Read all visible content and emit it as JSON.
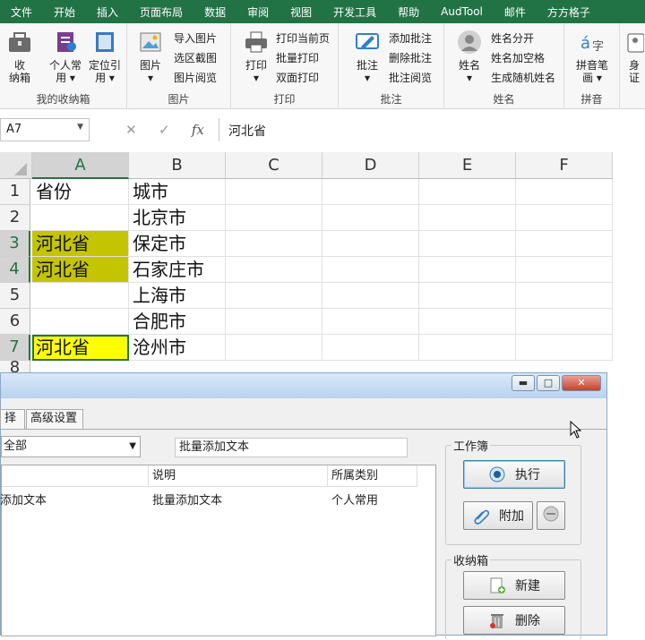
{
  "menu_tabs": [
    "文件",
    "开始",
    "插入",
    "页面布局",
    "数据",
    "审阅",
    "视图",
    "开发工具",
    "帮助",
    "AudTool",
    "邮件",
    "方方格子"
  ],
  "ribbon": {
    "storage": {
      "group_label": "我的收纳箱",
      "btn_collect": "收\n纳箱",
      "btn_personal": "个人常\n用 ▾",
      "btn_locate": "定位引\n用 ▾"
    },
    "picture": {
      "group_label": "图片",
      "btn_picture": "图片\n▾",
      "import": "导入图片",
      "screenshot": "选区截图",
      "browse": "图片阅览"
    },
    "print": {
      "group_label": "打印",
      "btn_print": "打印\n▾",
      "current": "打印当前页",
      "batch": "批量打印",
      "duplex": "双面打印"
    },
    "comment": {
      "group_label": "批注",
      "btn_comment": "批注\n▾",
      "add": "添加批注",
      "delete": "删除批注",
      "browse": "批注阅览"
    },
    "name": {
      "group_label": "姓名",
      "btn_name": "姓名\n▾",
      "split": "姓名分开",
      "space": "姓名加空格",
      "random": "生成随机姓名"
    },
    "pinyin": {
      "group_label": "拼音",
      "btn_pinyin": "拼音笔\n画 ▾"
    },
    "extra": {
      "btn_id": "身\n证"
    }
  },
  "formula_bar": {
    "name_box": "A7",
    "cancel": "✕",
    "enter": "✓",
    "fx": "fx",
    "content": "河北省"
  },
  "columns": [
    "A",
    "B",
    "C",
    "D",
    "E",
    "F"
  ],
  "rows": [
    "1",
    "2",
    "3",
    "4",
    "5",
    "6",
    "7",
    "8"
  ],
  "cells": {
    "A1": "省份",
    "B1": "城市",
    "A2": "",
    "B2": "北京市",
    "A3": "河北省",
    "B3": "保定市",
    "A4": "河北省",
    "B4": "石家庄市",
    "A5": "",
    "B5": "上海市",
    "A6": "",
    "B6": "合肥市",
    "A7": "河北省",
    "B7": "沧州市"
  },
  "colors": {
    "excel_green": "#217346",
    "olive_fill": "#c4c400",
    "yellow_fill": "#ffff00"
  },
  "dialog": {
    "tab_partial": "择",
    "tab_advanced": "高级设置",
    "combo_value": "全部",
    "textbox_value": "批量添加文本",
    "list": {
      "headers": [
        "",
        "说明",
        "所属类别"
      ],
      "rows": [
        [
          "添加文本",
          "批量添加文本",
          "个人常用"
        ]
      ]
    },
    "workbook_group": "工作簿",
    "btn_execute": "执行",
    "btn_attach": "附加",
    "storage_group": "收纳箱",
    "btn_new": "新建",
    "btn_delete": "删除"
  }
}
